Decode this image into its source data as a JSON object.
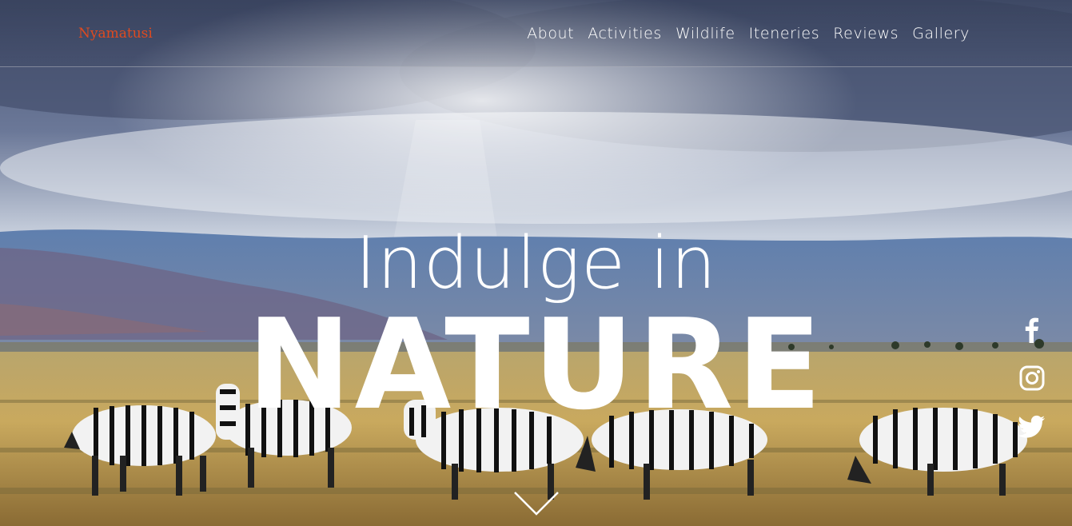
{
  "brand": {
    "name": "Nyamatusi",
    "color": "#e04a1f"
  },
  "nav": {
    "items": [
      {
        "label": "About"
      },
      {
        "label": "Activities"
      },
      {
        "label": "Wildlife"
      },
      {
        "label": "Iteneries"
      },
      {
        "label": "Reviews"
      },
      {
        "label": "Gallery"
      }
    ]
  },
  "hero": {
    "headline_line1": "Indulge in",
    "headline_line2": "NATURE"
  },
  "social": {
    "icons": [
      "facebook-icon",
      "instagram-icon",
      "twitter-icon"
    ]
  },
  "scroll_icon": "chevron-down-icon"
}
